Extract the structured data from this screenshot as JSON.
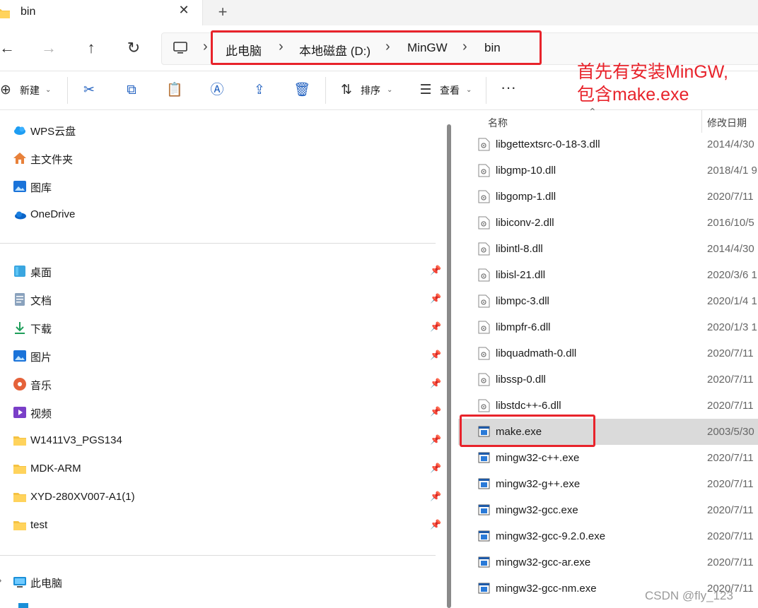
{
  "tab": {
    "title": "bin"
  },
  "address": {
    "crumbs": [
      "此电脑",
      "本地磁盘 (D:)",
      "MinGW",
      "bin"
    ]
  },
  "annotation": {
    "line1": "首先有安装MinGW,",
    "line2": "包含make.exe"
  },
  "toolbar": {
    "new_label": "新建",
    "sort_label": "排序",
    "view_label": "查看"
  },
  "sidebar": {
    "top_items": [
      {
        "label": "WPS云盘",
        "icon": "cloud-icon"
      },
      {
        "label": "主文件夹",
        "icon": "home-icon"
      },
      {
        "label": "图库",
        "icon": "gallery-icon"
      },
      {
        "label": "OneDrive",
        "icon": "onedrive-icon"
      }
    ],
    "quick_items": [
      {
        "label": "桌面",
        "icon": "desktop-icon"
      },
      {
        "label": "文档",
        "icon": "document-icon"
      },
      {
        "label": "下载",
        "icon": "download-icon"
      },
      {
        "label": "图片",
        "icon": "pictures-icon"
      },
      {
        "label": "音乐",
        "icon": "music-icon"
      },
      {
        "label": "视频",
        "icon": "video-icon"
      },
      {
        "label": "W1411V3_PGS134",
        "icon": "folder-icon"
      },
      {
        "label": "MDK-ARM",
        "icon": "folder-icon"
      },
      {
        "label": "XYD-280XV007-A1(1)",
        "icon": "folder-icon"
      },
      {
        "label": "test",
        "icon": "folder-icon"
      }
    ],
    "pc_item": {
      "label": "此电脑",
      "icon": "computer-icon"
    }
  },
  "files": {
    "col_name": "名称",
    "col_date": "修改日期",
    "rows": [
      {
        "name": "libgettextsrc-0-18-3.dll",
        "date": "2014/4/30",
        "type": "dll"
      },
      {
        "name": "libgmp-10.dll",
        "date": "2018/4/1 9",
        "type": "dll"
      },
      {
        "name": "libgomp-1.dll",
        "date": "2020/7/11",
        "type": "dll"
      },
      {
        "name": "libiconv-2.dll",
        "date": "2016/10/5",
        "type": "dll"
      },
      {
        "name": "libintl-8.dll",
        "date": "2014/4/30",
        "type": "dll"
      },
      {
        "name": "libisl-21.dll",
        "date": "2020/3/6 1",
        "type": "dll"
      },
      {
        "name": "libmpc-3.dll",
        "date": "2020/1/4 1",
        "type": "dll"
      },
      {
        "name": "libmpfr-6.dll",
        "date": "2020/1/3 1",
        "type": "dll"
      },
      {
        "name": "libquadmath-0.dll",
        "date": "2020/7/11",
        "type": "dll"
      },
      {
        "name": "libssp-0.dll",
        "date": "2020/7/11",
        "type": "dll"
      },
      {
        "name": "libstdc++-6.dll",
        "date": "2020/7/11",
        "type": "dll"
      },
      {
        "name": "make.exe",
        "date": "2003/5/30",
        "type": "exe",
        "selected": true
      },
      {
        "name": "mingw32-c++.exe",
        "date": "2020/7/11",
        "type": "exe"
      },
      {
        "name": "mingw32-g++.exe",
        "date": "2020/7/11",
        "type": "exe"
      },
      {
        "name": "mingw32-gcc.exe",
        "date": "2020/7/11",
        "type": "exe"
      },
      {
        "name": "mingw32-gcc-9.2.0.exe",
        "date": "2020/7/11",
        "type": "exe"
      },
      {
        "name": "mingw32-gcc-ar.exe",
        "date": "2020/7/11",
        "type": "exe"
      },
      {
        "name": "mingw32-gcc-nm.exe",
        "date": "2020/7/11",
        "type": "exe"
      }
    ]
  },
  "watermark": "CSDN @fly_123",
  "colors": {
    "highlight": "#e8232b",
    "accent": "#1f5fbf",
    "selected_row": "#dadada"
  }
}
